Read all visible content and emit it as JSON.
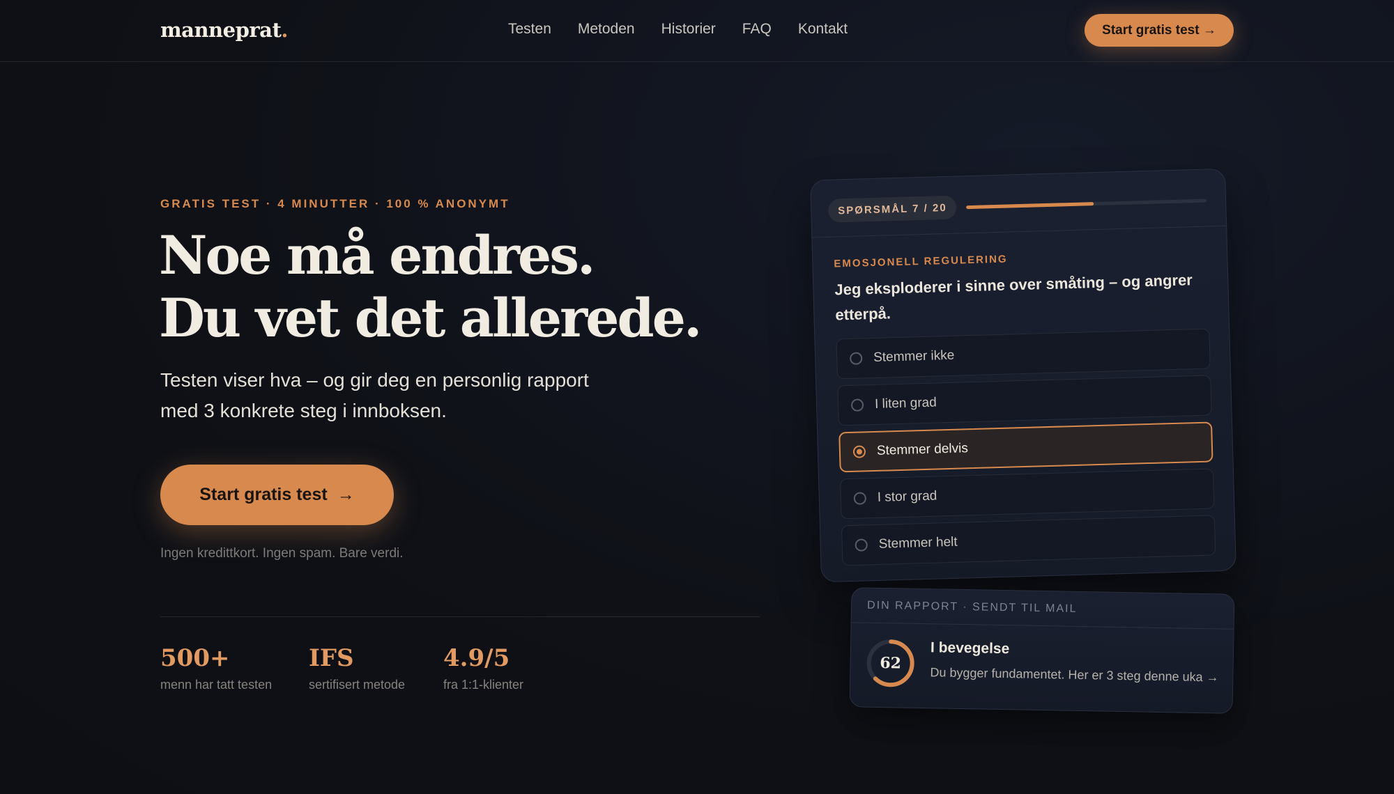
{
  "nav": {
    "logo": "manneprat",
    "logo_dot": ".",
    "links": [
      "Testen",
      "Metoden",
      "Historier",
      "FAQ",
      "Kontakt"
    ],
    "cta": "Start gratis test →"
  },
  "hero": {
    "eyebrow": "GRATIS TEST · 4 MINUTTER · 100 % ANONYMT",
    "headline_1": "Noe må endres.",
    "headline_2": "Du vet det allerede.",
    "subtitle_1": "Testen viser hva – og gir deg en personlig rapport",
    "subtitle_2": "med 3 konkrete steg i innboksen.",
    "cta_label": "Start gratis test",
    "cta_arrow": "→",
    "reassurance": "Ingen kredittkort. Ingen spam. Bare verdi."
  },
  "stats": [
    {
      "value": "500+",
      "label": "menn har tatt testen"
    },
    {
      "value": "IFS",
      "label": "sertifisert metode"
    },
    {
      "value": "4.9/5",
      "label": "fra 1:1-klienter"
    }
  ],
  "quiz": {
    "progress_label": "SPØRSMÅL 7 / 20",
    "progress_fraction": 0.53,
    "category": "EMOSJONELL REGULERING",
    "question": "Jeg eksploderer i sinne over småting – og angrer etterpå.",
    "options": [
      "Stemmer ikke",
      "I liten grad",
      "Stemmer delvis",
      "I stor grad",
      "Stemmer helt"
    ],
    "selected_index": 2
  },
  "report": {
    "header": "DIN RAPPORT · SENDT TIL MAIL",
    "score": "62",
    "score_fraction": 0.62,
    "title": "I bevegelse",
    "text": "Du bygger fundamentet. Her er 3 steg denne uka →"
  },
  "colors": {
    "accent": "#d88a4e",
    "background": "#0f1117",
    "card": "#1a2030"
  }
}
